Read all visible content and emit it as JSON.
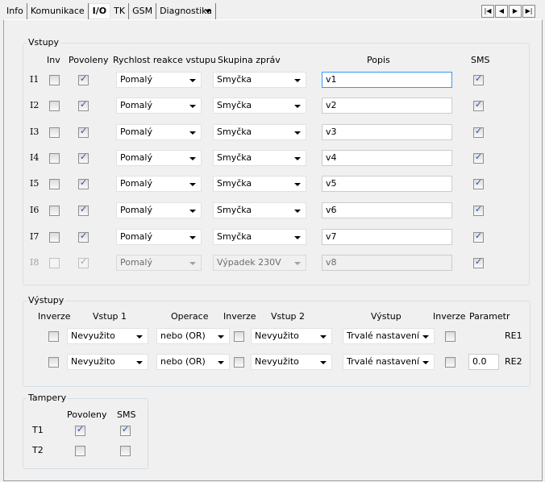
{
  "tabs": [
    {
      "label": "Info"
    },
    {
      "label": "Komunikace"
    },
    {
      "label": "I/O",
      "selected": true
    },
    {
      "label": "TK"
    },
    {
      "label": "GSM"
    },
    {
      "label": "Diagnostika"
    }
  ],
  "nav": {
    "icons": [
      "first-icon",
      "prev-icon",
      "next-icon",
      "last-icon"
    ]
  },
  "vstupy": {
    "title": "Vstupy",
    "headers": {
      "inv": "Inv",
      "povoleny": "Povoleny",
      "rychlost": "Rychlost reakce vstupu",
      "skupina": "Skupina zpráv",
      "popis": "Popis",
      "sms": "SMS"
    },
    "rows": [
      {
        "label": "I1",
        "inv": false,
        "povoleny": true,
        "rychlost": "Pomalý",
        "skupina": "Smyčka",
        "popis": "v1",
        "sms": true,
        "enabled": true
      },
      {
        "label": "I2",
        "inv": false,
        "povoleny": true,
        "rychlost": "Pomalý",
        "skupina": "Smyčka",
        "popis": "v2",
        "sms": true,
        "enabled": true
      },
      {
        "label": "I3",
        "inv": false,
        "povoleny": true,
        "rychlost": "Pomalý",
        "skupina": "Smyčka",
        "popis": "v3",
        "sms": true,
        "enabled": true
      },
      {
        "label": "I4",
        "inv": false,
        "povoleny": true,
        "rychlost": "Pomalý",
        "skupina": "Smyčka",
        "popis": "v4",
        "sms": true,
        "enabled": true
      },
      {
        "label": "I5",
        "inv": false,
        "povoleny": true,
        "rychlost": "Pomalý",
        "skupina": "Smyčka",
        "popis": "v5",
        "sms": true,
        "enabled": true
      },
      {
        "label": "I6",
        "inv": false,
        "povoleny": true,
        "rychlost": "Pomalý",
        "skupina": "Smyčka",
        "popis": "v6",
        "sms": true,
        "enabled": true
      },
      {
        "label": "I7",
        "inv": false,
        "povoleny": true,
        "rychlost": "Pomalý",
        "skupina": "Smyčka",
        "popis": "v7",
        "sms": true,
        "enabled": true
      },
      {
        "label": "I8",
        "inv": false,
        "povoleny": true,
        "rychlost": "Pomalý",
        "skupina": "Výpadek 230V",
        "popis": "v8",
        "sms": true,
        "enabled": false
      }
    ]
  },
  "vystupy": {
    "title": "Výstupy",
    "headers": {
      "inverze1": "Inverze",
      "vstup1": "Vstup 1",
      "operace": "Operace",
      "inverze2": "Inverze",
      "vstup2": "Vstup 2",
      "vystup": "Výstup",
      "inverze3": "Inverze",
      "parametr": "Parametr"
    },
    "rows": [
      {
        "inv1": false,
        "vstup1": "Nevyužito",
        "operace": "nebo (OR)",
        "inv2": false,
        "vstup2": "Nevyužito",
        "vystup": "Trvalé nastavení",
        "inv3": false,
        "parametr": null,
        "label": "RE1"
      },
      {
        "inv1": false,
        "vstup1": "Nevyužito",
        "operace": "nebo (OR)",
        "inv2": false,
        "vstup2": "Nevyužito",
        "vystup": "Trvalé nastavení",
        "inv3": false,
        "parametr": "0.0",
        "label": "RE2"
      }
    ]
  },
  "tampery": {
    "title": "Tampery",
    "headers": {
      "povoleny": "Povoleny",
      "sms": "SMS"
    },
    "rows": [
      {
        "label": "T1",
        "povoleny": true,
        "sms": true
      },
      {
        "label": "T2",
        "povoleny": false,
        "sms": false
      }
    ]
  }
}
